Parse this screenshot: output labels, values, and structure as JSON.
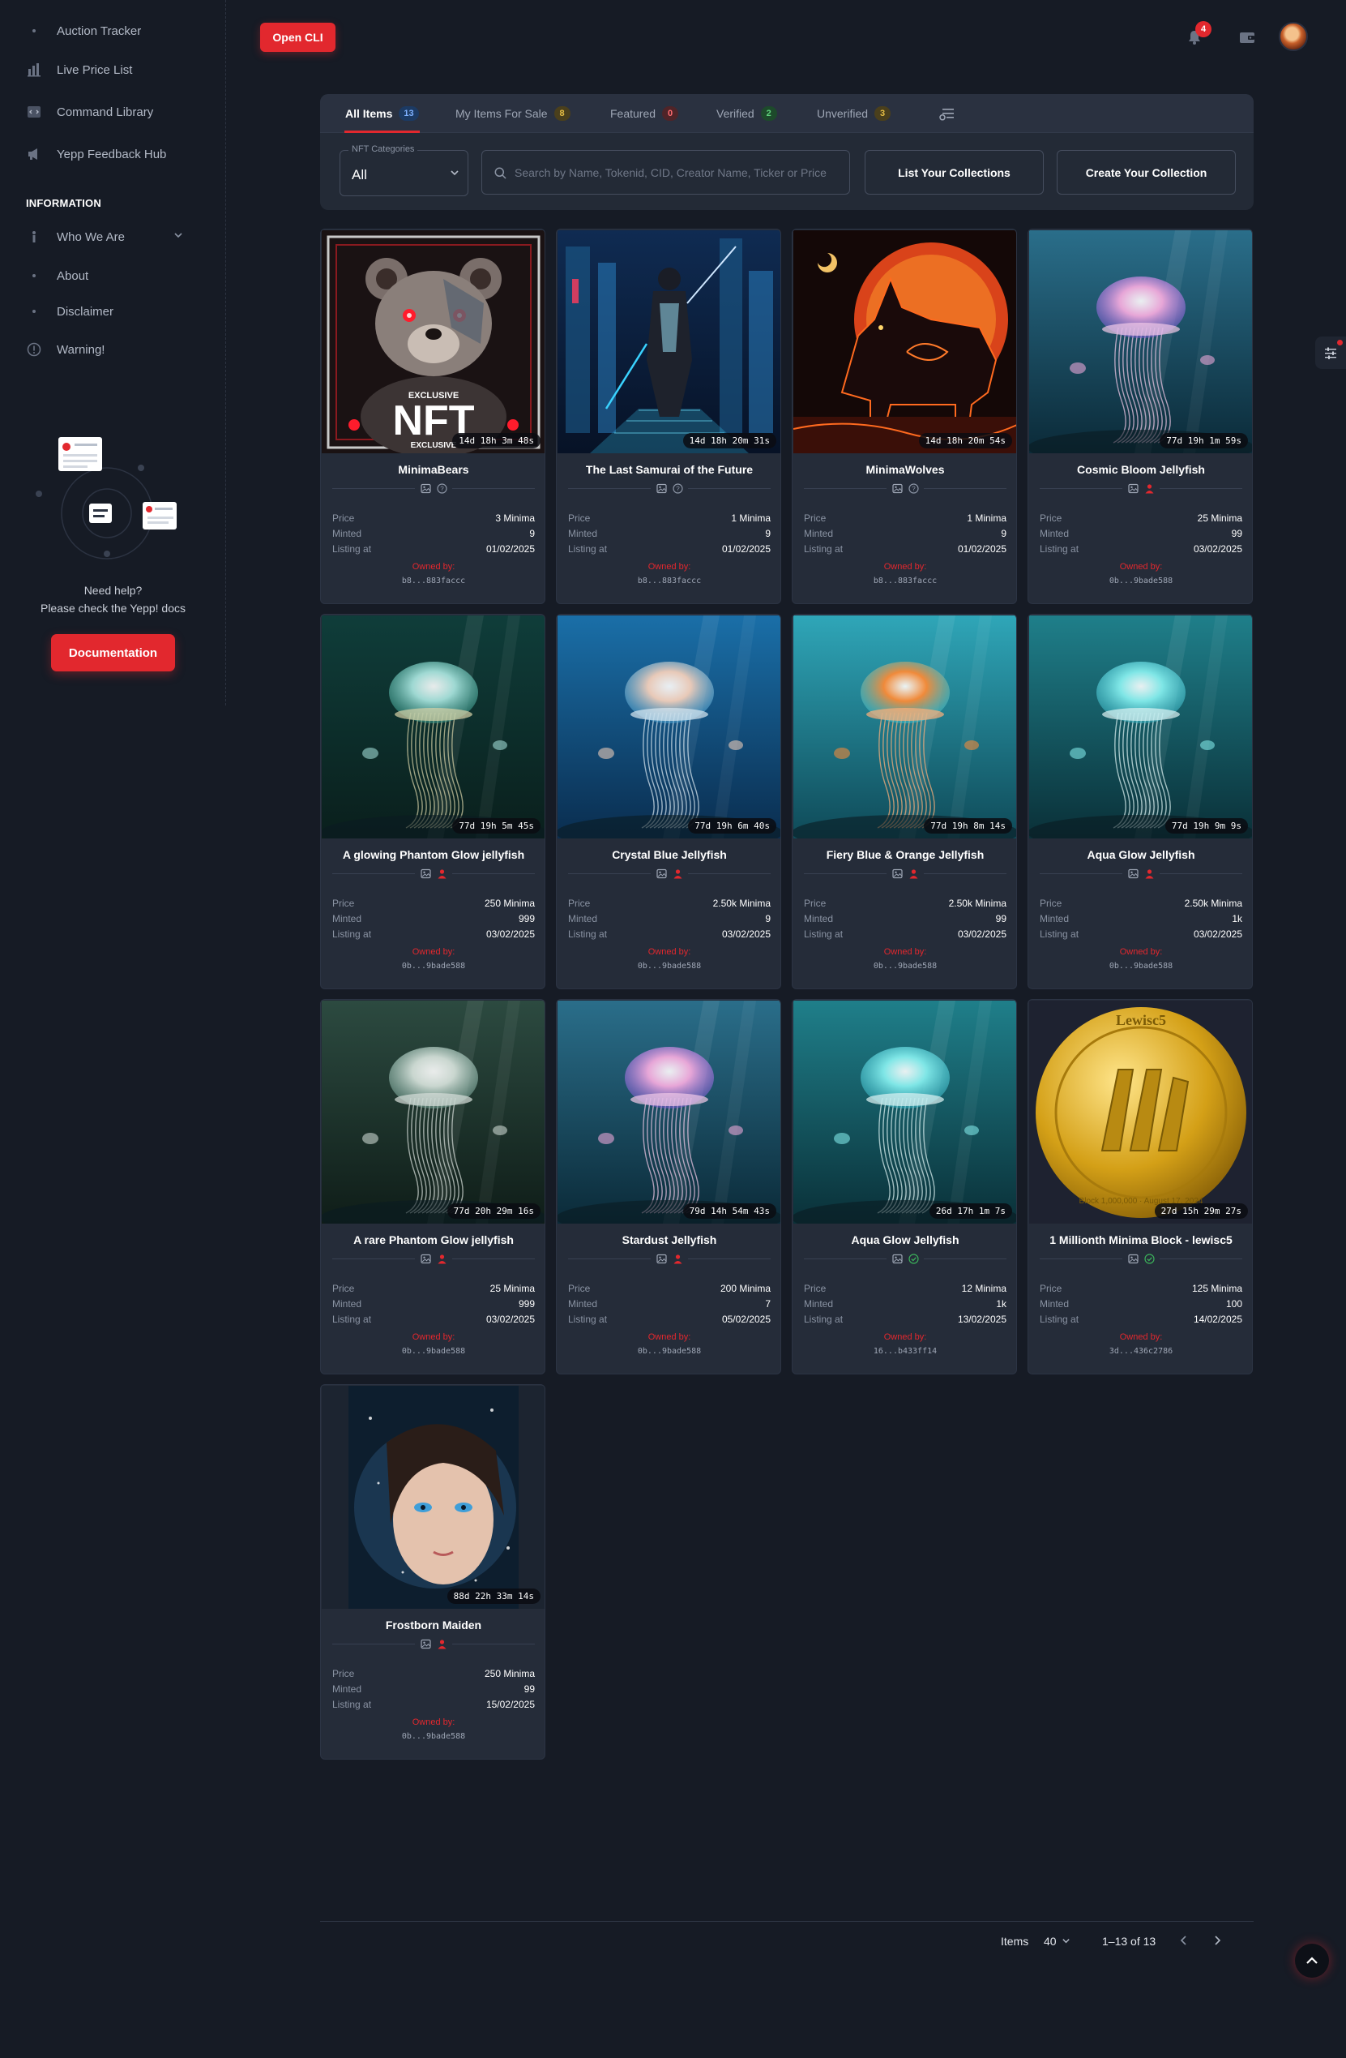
{
  "sidebar": {
    "items_top": [
      {
        "label": "Auction Tracker",
        "icon": "dot-icon"
      },
      {
        "label": "Live Price List",
        "icon": "bar-chart-icon"
      },
      {
        "label": "Command Library",
        "icon": "code-icon"
      },
      {
        "label": "Yepp Feedback Hub",
        "icon": "megaphone-icon"
      }
    ],
    "section_heading": "INFORMATION",
    "info_items": [
      {
        "label": "Who We Are",
        "icon": "info-icon"
      },
      {
        "label": "About",
        "icon": "dot-icon"
      },
      {
        "label": "Disclaimer",
        "icon": "dot-icon"
      },
      {
        "label": "Warning!",
        "icon": "alert-icon"
      }
    ],
    "help_line1": "Need help?",
    "help_line2": "Please check the Yepp! docs",
    "documentation_button": "Documentation"
  },
  "topbar": {
    "open_cli": "Open CLI",
    "notifications_count": "4"
  },
  "tabs": [
    {
      "label": "All Items",
      "count": "13",
      "active": true,
      "color": "#3d7ee0"
    },
    {
      "label": "My Items For Sale",
      "count": "8",
      "active": false,
      "color": "#d9a520"
    },
    {
      "label": "Featured",
      "count": "0",
      "active": false,
      "color": "#e2282e"
    },
    {
      "label": "Verified",
      "count": "2",
      "active": false,
      "color": "#3bb05a"
    },
    {
      "label": "Unverified",
      "count": "3",
      "active": false,
      "color": "#d9a520"
    }
  ],
  "filters": {
    "category_label": "NFT Categories",
    "category_value": "All",
    "search_placeholder": "Search by Name, Tokenid, CID, Creator Name, Ticker or Price",
    "list_collections": "List Your Collections",
    "create_collection": "Create Your Collection"
  },
  "field_labels": {
    "price": "Price",
    "minted": "Minted",
    "listing": "Listing at",
    "owned_by": "Owned by:"
  },
  "items": [
    {
      "title": "MinimaBears",
      "timer": "14d 18h 3m 48s",
      "price": "3 Minima",
      "minted": "9",
      "listing": "01/02/2025",
      "owner": "b8...883faccc",
      "status": "unverified",
      "art": "bear"
    },
    {
      "title": "The Last Samurai of the Future",
      "timer": "14d 18h 20m 31s",
      "price": "1 Minima",
      "minted": "9",
      "listing": "01/02/2025",
      "owner": "b8...883faccc",
      "status": "unverified",
      "art": "samurai"
    },
    {
      "title": "MinimaWolves",
      "timer": "14d 18h 20m 54s",
      "price": "1 Minima",
      "minted": "9",
      "listing": "01/02/2025",
      "owner": "b8...883faccc",
      "status": "unverified",
      "art": "wolf"
    },
    {
      "title": "Cosmic Bloom Jellyfish",
      "timer": "77d 19h 1m 59s",
      "price": "25 Minima",
      "minted": "99",
      "listing": "03/02/2025",
      "owner": "0b...9bade588",
      "status": "user",
      "art": "jelly-pink"
    },
    {
      "title": "A glowing Phantom Glow jellyfish",
      "timer": "77d 19h 5m 45s",
      "price": "250 Minima",
      "minted": "999",
      "listing": "03/02/2025",
      "owner": "0b...9bade588",
      "status": "user",
      "art": "jelly-green"
    },
    {
      "title": "Crystal Blue Jellyfish",
      "timer": "77d 19h 6m 40s",
      "price": "2.50k Minima",
      "minted": "9",
      "listing": "03/02/2025",
      "owner": "0b...9bade588",
      "status": "user",
      "art": "jelly-blue"
    },
    {
      "title": "Fiery Blue & Orange Jellyfish",
      "timer": "77d 19h 8m 14s",
      "price": "2.50k Minima",
      "minted": "99",
      "listing": "03/02/2025",
      "owner": "0b...9bade588",
      "status": "user",
      "art": "jelly-orange"
    },
    {
      "title": "Aqua Glow Jellyfish",
      "timer": "77d 19h 9m 9s",
      "price": "2.50k Minima",
      "minted": "1k",
      "listing": "03/02/2025",
      "owner": "0b...9bade588",
      "status": "user",
      "art": "jelly-aqua"
    },
    {
      "title": "A rare Phantom Glow jellyfish",
      "timer": "77d 20h 29m 16s",
      "price": "25 Minima",
      "minted": "999",
      "listing": "03/02/2025",
      "owner": "0b...9bade588",
      "status": "user",
      "art": "jelly-murky"
    },
    {
      "title": "Stardust Jellyfish",
      "timer": "79d 14h 54m 43s",
      "price": "200 Minima",
      "minted": "7",
      "listing": "05/02/2025",
      "owner": "0b...9bade588",
      "status": "user",
      "art": "jelly-pink"
    },
    {
      "title": "Aqua Glow Jellyfish",
      "timer": "26d 17h 1m 7s",
      "price": "12 Minima",
      "minted": "1k",
      "listing": "13/02/2025",
      "owner": "16...b433ff14",
      "status": "verified",
      "art": "jelly-aqua"
    },
    {
      "title": "1 Millionth Minima Block - lewisc5",
      "timer": "27d 15h 29m 27s",
      "price": "125 Minima",
      "minted": "100",
      "listing": "14/02/2025",
      "owner": "3d...436c2786",
      "status": "verified",
      "art": "coin"
    },
    {
      "title": "Frostborn Maiden",
      "timer": "88d 22h 33m 14s",
      "price": "250 Minima",
      "minted": "99",
      "listing": "15/02/2025",
      "owner": "0b...9bade588",
      "status": "user",
      "art": "maiden"
    }
  ],
  "art_text": {
    "bear_top": "EXCLUSIVE",
    "bear_big": "NFT",
    "bear_bottom": "EXCLUSIVE",
    "coin_top": "Lewisc5",
    "coin_bottom": "Block 1,000,000 · August 17, 2024"
  },
  "pager": {
    "items_label": "Items",
    "per_page": "40",
    "range": "1–13 of 13"
  },
  "colors": {
    "accent": "#e2282e",
    "background": "#161b25",
    "card": "#252c39",
    "verified": "#3bb05a"
  }
}
